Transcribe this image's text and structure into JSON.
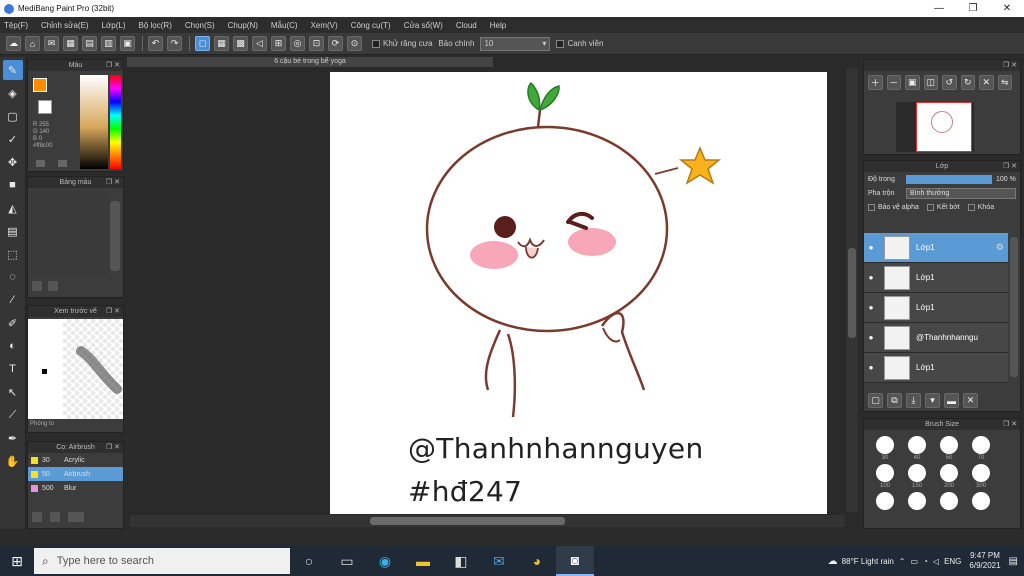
{
  "window": {
    "title": "MediBang Paint Pro (32bit)",
    "controls": [
      "—",
      "❐",
      "✕"
    ]
  },
  "menu": [
    "Tệp(F)",
    "Chỉnh sửa(E)",
    "Lớp(L)",
    "Bộ lọc(R)",
    "Chọn(S)",
    "Chụp(N)",
    "Mẫu(C)",
    "Xem(V)",
    "Công cụ(T)",
    "Cửa sổ(W)",
    "Cloud",
    "Help"
  ],
  "toolbar": {
    "check_label": "Khử răng cưa",
    "select_label": "Bảo chính",
    "select_value": "10",
    "right_label": "Canh viền"
  },
  "panels": {
    "color": "Màu",
    "color_hex": "#ff8c00",
    "color_lines": [
      "R 255",
      "G 140",
      "B 0",
      "#ff8c00"
    ],
    "palette": "Bảng màu",
    "navigator_label": "Xem trước vẽ",
    "layers": "Lớp",
    "opacity_label": "Độ trong",
    "opacity_value": "100 %",
    "blend_label": "Pha trộn",
    "blend_value": "Bình thường",
    "layer_opts": [
      "Bảo vệ alpha",
      "Kết bớt",
      "Khóa"
    ],
    "brush_size": "Brush Size",
    "brush_panel": "Cọ: Airbrush",
    "brushes": [
      {
        "size": "30",
        "name": "Acrylic"
      },
      {
        "size": "50",
        "name": "Airbrush"
      },
      {
        "size": "500",
        "name": "Blur"
      }
    ],
    "preview_label": "Phóng to"
  },
  "layers": [
    {
      "name": "Lớp1",
      "selected": true
    },
    {
      "name": "Lớp1",
      "selected": false
    },
    {
      "name": "Lớp1",
      "selected": false
    },
    {
      "name": "@Thanhnhanngu",
      "selected": false
    },
    {
      "name": "Lớp1",
      "selected": false
    }
  ],
  "brush_sizes": [
    "30",
    "40",
    "50",
    "70",
    "100",
    "150",
    "200",
    "300",
    "",
    "",
    "",
    ""
  ],
  "document_tab": "6 cậu bé trong bể yoga",
  "canvas_text": {
    "line1": "@Thanhnhannguyen",
    "line2": "#hđ247"
  },
  "taskbar": {
    "search_placeholder": "Type here to search",
    "weather": "88°F  Light rain",
    "lang": "ENG",
    "time": "9:47 PM",
    "date": "6/9/2021"
  }
}
